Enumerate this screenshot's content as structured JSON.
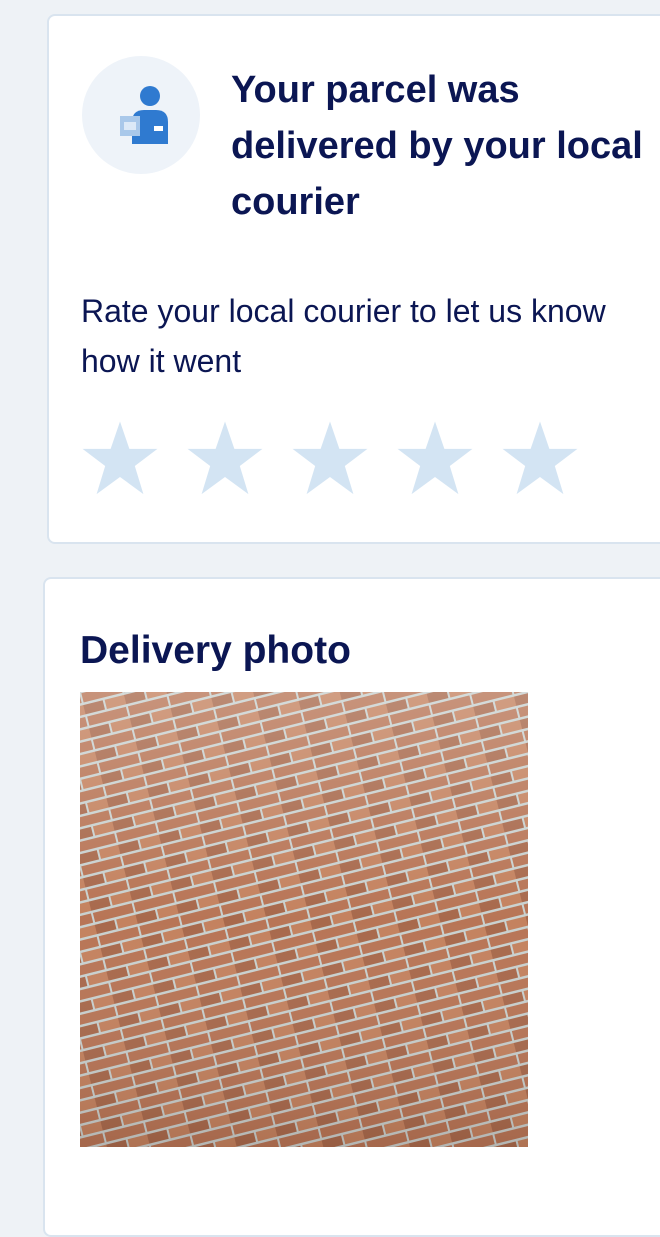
{
  "courier_card": {
    "icon": "courier-with-parcel-icon",
    "title": "Your parcel was delivered by your local courier",
    "rate_prompt": "Rate your local courier to let us know how it went",
    "rating": {
      "max_stars": 5,
      "selected": 0,
      "star_color": "#d3e4f3"
    }
  },
  "photo_card": {
    "title": "Delivery photo",
    "photo_subject": "brick-wall-photo"
  },
  "colors": {
    "heading": "#0b1653",
    "background": "#eef2f6",
    "card_border": "#d9e4ef",
    "icon_blue": "#2f7ad0"
  }
}
